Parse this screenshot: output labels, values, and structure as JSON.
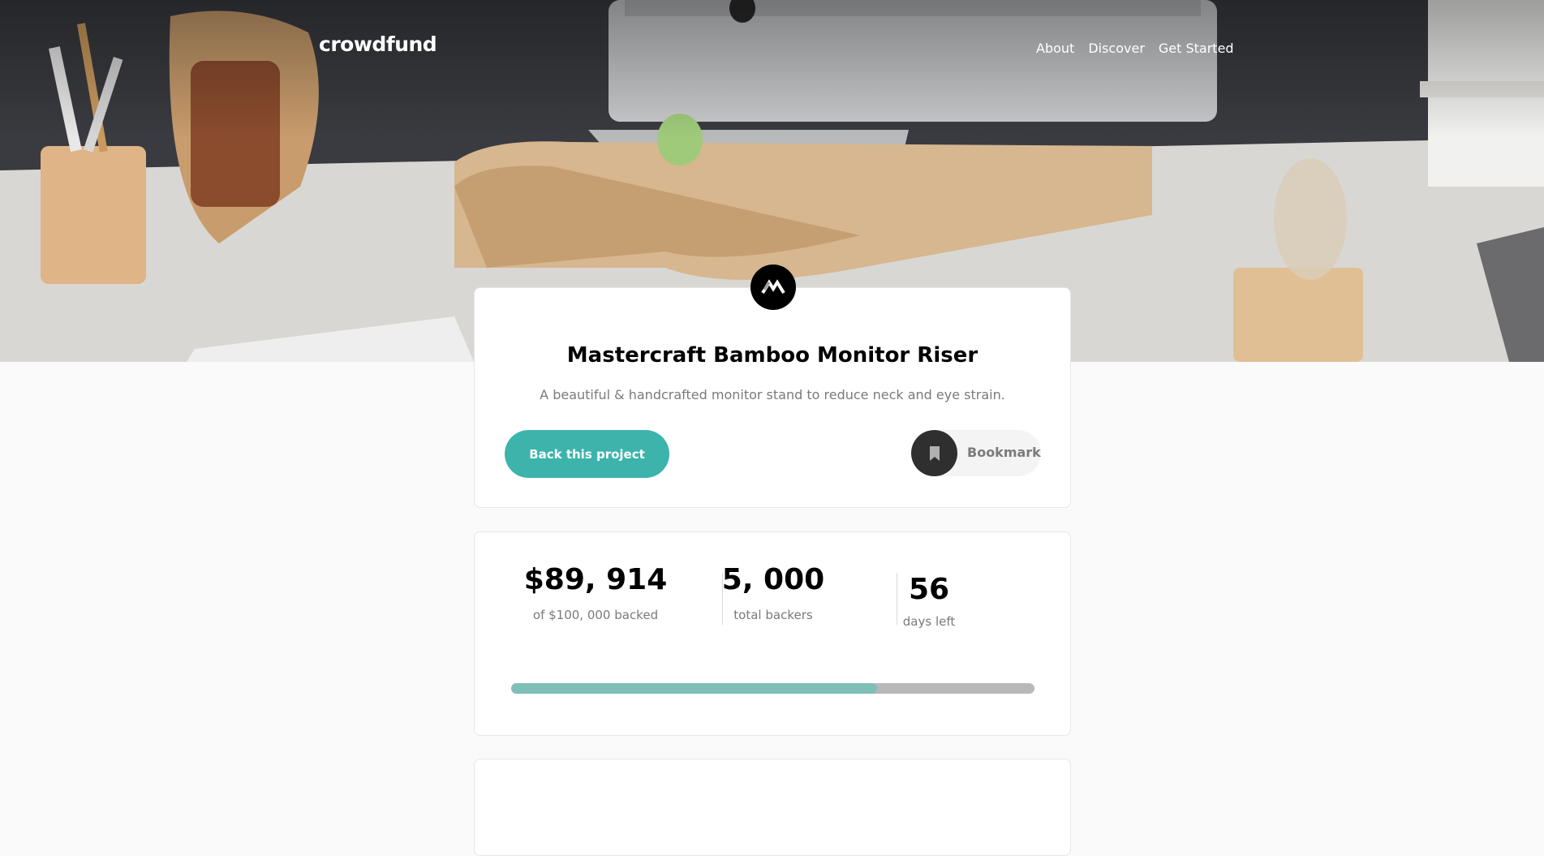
{
  "header": {
    "logo": "crowdfund",
    "nav": [
      "About",
      "Discover",
      "Get Started"
    ]
  },
  "project": {
    "logo_icon": "mastercraft-logo-icon",
    "title": "Mastercraft Bamboo Monitor Riser",
    "subtitle": "A beautiful & handcrafted monitor stand to reduce neck and eye strain.",
    "back_label": "Back this project",
    "bookmark_label": "Bookmark",
    "bookmark_icon": "bookmark-icon"
  },
  "stats": {
    "backed_value": "$89, 914",
    "backed_label": "of $100, 000 backed",
    "backers_value": "5, 000",
    "backers_label": "total backers",
    "days_value": "56",
    "days_label": "days left",
    "progress_fraction": 0.6985
  },
  "colors": {
    "accent": "#3cb4ac",
    "progress_fill": "#7fbfb6",
    "progress_track": "#b8b8b8",
    "dark": "#2f2f2f"
  }
}
